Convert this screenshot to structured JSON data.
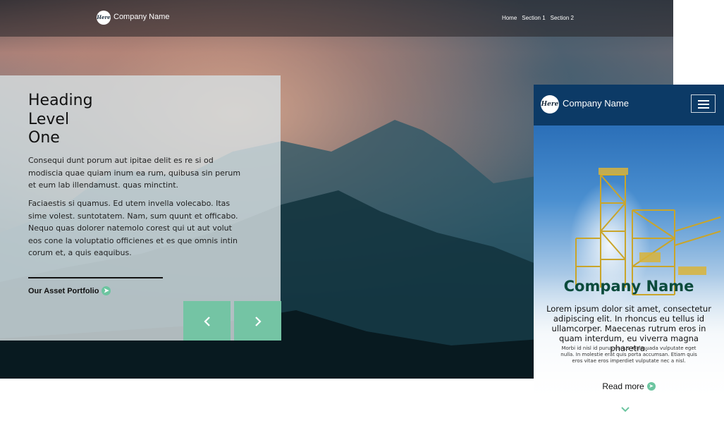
{
  "desktop": {
    "nav": {
      "logo_text": "Here",
      "company": "Company Name",
      "links": [
        "Home",
        "Section 1",
        "Section 2"
      ]
    },
    "hero": {
      "heading_line1": "Heading",
      "heading_line2": "Level",
      "heading_line3": "One",
      "paragraph1": "Consequi dunt porum aut ipitae delit es re si od modiscia quae quiam inum ea rum, quibusa sin perum et eum lab illendamust. quas minctint.",
      "paragraph2": "Faciaestis si quamus. Ed utem invella volecabo. Itas sime volest. suntotatem. Nam, sum quunt et officabo. Nequo quas dolorer natemolo corest qui ut aut volut eos cone la voluptatio officienes et es que omnis intin corum et, a quis eaquibus.",
      "link": "Our Asset Portfolio",
      "prev": "‹",
      "next": "›"
    },
    "colors": {
      "accent": "#74c4a4"
    }
  },
  "mobile": {
    "header": {
      "logo_text": "Here",
      "company": "Company Name"
    },
    "hero": {
      "title": "Company Name",
      "body": "Lorem ipsum dolor sit amet, consectetur adipiscing elit. In rhoncus eu tellus id ullamcorper. Maecenas rutrum eros in quam interdum, eu viverra magna pharetra.",
      "small": "Morbi id nisl id purus varius malesuada vulputate eget nulla. In molestie erat quis porta accumsan. Etiam quis eros vitae eros imperdiet vulputate nec a nisl.",
      "read_more": "Read more"
    },
    "colors": {
      "header": "#0c3a66",
      "title": "#0b4b3c"
    }
  }
}
